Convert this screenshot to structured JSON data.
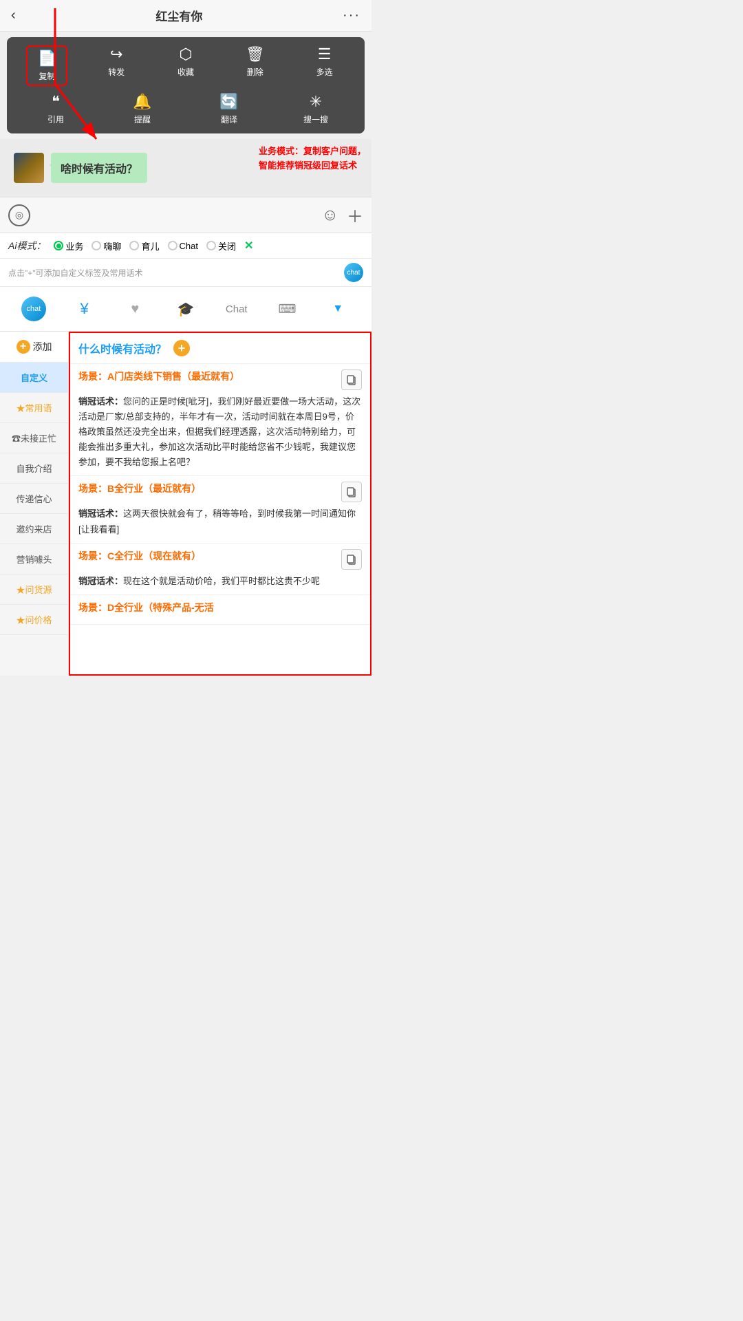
{
  "header": {
    "back": "‹",
    "title": "红尘有你",
    "more": "···"
  },
  "context_menu": {
    "row1": [
      {
        "icon": "📄",
        "label": "复制",
        "highlight": true
      },
      {
        "icon": "↪",
        "label": "转发"
      },
      {
        "icon": "⬡",
        "label": "收藏"
      },
      {
        "icon": "🗑",
        "label": "删除"
      },
      {
        "icon": "☰",
        "label": "多选"
      }
    ],
    "row2": [
      {
        "icon": "❝",
        "label": "引用"
      },
      {
        "icon": "🔔",
        "label": "提醒"
      },
      {
        "icon": "🔄",
        "label": "翻译"
      },
      {
        "icon": "✳",
        "label": "搜一搜"
      }
    ]
  },
  "annotation": {
    "text": "业务模式：复制客户问题，\n智能推荐销冠级回复话术"
  },
  "chat": {
    "message": "啥时候有活动？",
    "avatar_alt": "avatar"
  },
  "input_bar": {
    "placeholder": "",
    "cursor": "|"
  },
  "ai_modes": {
    "label": "Ai模式：",
    "options": [
      {
        "label": "业务",
        "active": true
      },
      {
        "label": "嗨聊",
        "active": false
      },
      {
        "label": "育儿",
        "active": false
      },
      {
        "label": "Chat",
        "active": false
      },
      {
        "label": "关闭",
        "active": false
      }
    ],
    "close": "✕"
  },
  "hint_bar": {
    "text": "点击\"+\"可添加自定义标签及常用话术"
  },
  "toolbar": {
    "items": [
      {
        "icon": "robot",
        "label": "chat"
      },
      {
        "icon": "¥",
        "label": "money"
      },
      {
        "icon": "♥",
        "label": "heart"
      },
      {
        "icon": "🎓",
        "label": "graduation"
      },
      {
        "icon": "Chat",
        "label": "chat-text"
      },
      {
        "icon": "⌨",
        "label": "keyboard"
      },
      {
        "icon": "▼",
        "label": "dropdown"
      }
    ]
  },
  "sidebar": {
    "add_label": "添加",
    "items": [
      {
        "label": "自定义",
        "active": true
      },
      {
        "label": "★常用语",
        "star": true
      },
      {
        "label": "☎未接正忙"
      },
      {
        "label": "自我介绍"
      },
      {
        "label": "传递信心"
      },
      {
        "label": "邀约来店"
      },
      {
        "label": "营销噱头"
      },
      {
        "label": "★问货源",
        "star": true
      },
      {
        "label": "★问价格",
        "star": true
      }
    ]
  },
  "content": {
    "question": "什么时候有活动？",
    "scenarios": [
      {
        "title": "场景：A门店类线下销售（最近就有）",
        "sales_label": "销冠话术：",
        "sales_text": "您问的正是时候[呲牙]，我们刚好最近要做一场大活动，这次活动是厂家/总部支持的，半年才有一次，活动时间就在本周日9号，价格政策虽然还没完全出来，但据我们经理透露，这次活动特别给力，可能会推出多重大礼，参加这次活动比平时能给您省不少钱呢，我建议您参加，要不我给您报上名吧？"
      },
      {
        "title": "场景：B全行业（最近就有）",
        "sales_label": "销冠话术：",
        "sales_text": "这两天很快就会有了，稍等等哈，到时候我第一时间通知你[让我看看]"
      },
      {
        "title": "场景：C全行业（现在就有）",
        "sales_label": "销冠话术：",
        "sales_text": "现在这个就是活动价哈，我们平时都比这贵不少呢"
      },
      {
        "title": "场景：D全行业（特殊产品-无活",
        "sales_label": "",
        "sales_text": ""
      }
    ]
  }
}
